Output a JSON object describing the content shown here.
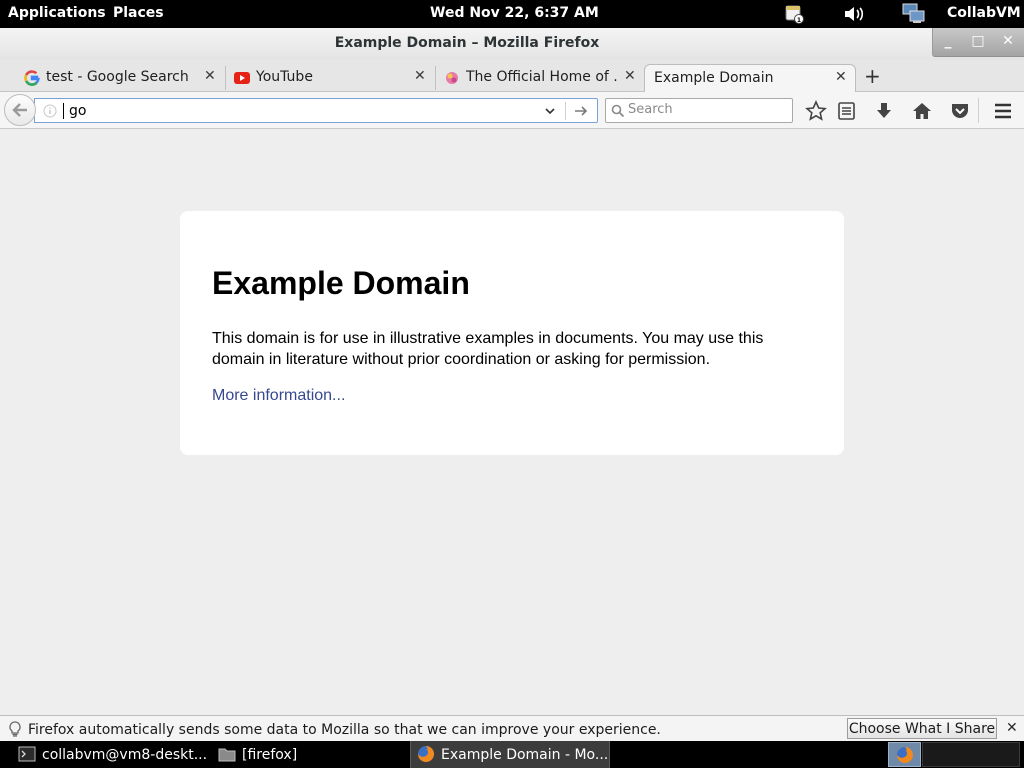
{
  "top_panel": {
    "applications": "Applications",
    "places": "Places",
    "clock": "Wed Nov 22,  6:37 AM",
    "user": "CollabVM"
  },
  "window": {
    "title": "Example Domain – Mozilla Firefox",
    "minimize": "_",
    "maximize": "□",
    "close": "✕"
  },
  "tabs": [
    {
      "label": "test - Google Search",
      "icon": "google-icon",
      "close": "✕"
    },
    {
      "label": "YouTube",
      "icon": "youtube-icon",
      "close": "✕"
    },
    {
      "label": "The Official Home of ...",
      "icon": "page-icon",
      "close": "✕"
    },
    {
      "label": "Example Domain",
      "icon": "none",
      "close": "✕",
      "active": true
    }
  ],
  "new_tab": "+",
  "nav": {
    "url_value": "go",
    "search_placeholder": "Search"
  },
  "page": {
    "heading": "Example Domain",
    "paragraph": "This domain is for use in illustrative examples in documents. You may use this domain in literature without prior coordination or asking for permission.",
    "link": "More information..."
  },
  "notification": {
    "text": "Firefox automatically sends some data to Mozilla so that we can improve your experience.",
    "button": "Choose What I Share",
    "close": "✕"
  },
  "taskbar": {
    "items": [
      {
        "label": "collabvm@vm8-deskt...",
        "icon": "terminal-icon"
      },
      {
        "label": "[firefox]",
        "icon": "folder-icon"
      },
      {
        "label": "Example Domain - Mo...",
        "icon": "firefox-icon",
        "active": true
      }
    ]
  }
}
